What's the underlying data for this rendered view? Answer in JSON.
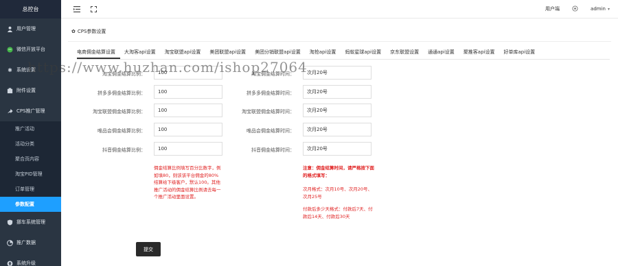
{
  "sidebar": {
    "brand": "总控台",
    "items": [
      {
        "label": "用户管理",
        "icon": "user-icon"
      },
      {
        "label": "微信开放平台",
        "icon": "wechat-icon"
      },
      {
        "label": "系统设置",
        "icon": "gear-icon"
      },
      {
        "label": "附件设置",
        "icon": "attachment-icon"
      },
      {
        "label": "CPS推广管理",
        "icon": "share-icon"
      }
    ],
    "sub_items": [
      "推广活动",
      "活动分类",
      "聚合页内容",
      "淘宝PID管理",
      "订单管理",
      "参数配置"
    ],
    "bottom_items": [
      {
        "label": "挪车系统管理",
        "icon": "shield-icon"
      },
      {
        "label": "推广数据",
        "icon": "chart-icon"
      },
      {
        "label": "系统升级",
        "icon": "upgrade-icon"
      }
    ]
  },
  "topbar": {
    "user_side": "用户端",
    "admin": "admin"
  },
  "panel": {
    "title": "CPS参数设置"
  },
  "tabs": [
    "电商佣金结算设置",
    "大淘客api设置",
    "淘宝联盟api设置",
    "美团联盟api设置",
    "美团分销联盟api设置",
    "淘抢api设置",
    "蚂蚁星球api设置",
    "京东联盟设置",
    "通通api设置",
    "聚推客api设置",
    "好单库api设置"
  ],
  "form": {
    "left_labels": [
      "淘宝佣金结算比例：",
      "拼多多佣金结算比例：",
      "淘宝联盟佣金结算比例：",
      "唯品会佣金结算比例：",
      "抖音佣金结算比例："
    ],
    "left_values": [
      "100",
      "100",
      "100",
      "100",
      "100"
    ],
    "right_labels": [
      "淘宝佣金结算时间：",
      "拼多多佣金结算时间：",
      "淘宝联盟佣金结算时间：",
      "唯品会佣金结算时间：",
      "抖音佣金结算时间："
    ],
    "right_values": [
      "次月20号",
      "次月20号",
      "次月20号",
      "次月20号",
      "次月20号"
    ],
    "left_note": "佣金结算比例填写百分比数字，例如填80，则该该平台佣金的80%结算给下级客户，默认100。其他推广活动的佣金结算比例请去每一个推广活动里面设置。",
    "right_note_title": "注意：佣金结算时间，请严格按下面的格式填写：",
    "right_note_1": "次月格式：次月10号、次月20号、次月25号",
    "right_note_2": "付款后多少天格式：付款后7天、付款后14天、付款后30天",
    "submit": "提交"
  },
  "watermark": "https://www.huzhan.com/ishop27064"
}
